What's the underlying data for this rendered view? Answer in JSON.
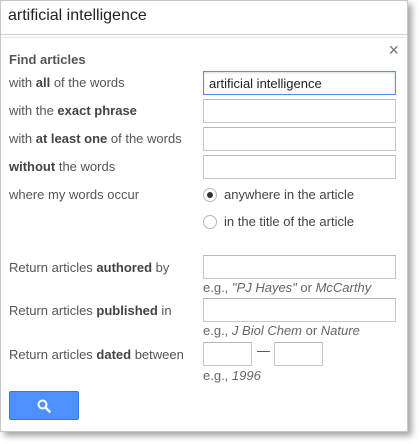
{
  "query": "artificial intelligence",
  "heading": "Find articles",
  "close_glyph": "×",
  "rows": {
    "all_words": {
      "pre": "with ",
      "bold": "all",
      "post": " of the words",
      "value": "artificial intelligence"
    },
    "exact_phrase": {
      "pre": "with the ",
      "bold": "exact phrase",
      "post": "",
      "value": ""
    },
    "at_least_one": {
      "pre": "with ",
      "bold": "at least one",
      "post": " of the words",
      "value": ""
    },
    "without": {
      "pre": "",
      "bold": "without",
      "post": " the words",
      "value": ""
    },
    "where": {
      "label": "where my words occur"
    },
    "authored": {
      "pre": "Return articles ",
      "bold": "authored",
      "post": " by",
      "value": ""
    },
    "published": {
      "pre": "Return articles ",
      "bold": "published",
      "post": " in",
      "value": ""
    },
    "dated": {
      "pre": "Return articles ",
      "bold": "dated",
      "post": " between",
      "value_from": "",
      "value_to": ""
    }
  },
  "occur_options": [
    {
      "label": "anywhere in the article",
      "selected": true
    },
    {
      "label": "in the title of the article",
      "selected": false
    }
  ],
  "hints": {
    "authored": {
      "prefix": "e.g., ",
      "ex1": "\"PJ Hayes\"",
      "mid": " or ",
      "ex2": "McCarthy"
    },
    "published": {
      "prefix": "e.g., ",
      "ex1": "J Biol Chem",
      "mid": " or ",
      "ex2": "Nature"
    },
    "dated": {
      "prefix": "e.g., ",
      "ex1": "1996"
    }
  },
  "date_separator": "—",
  "icons": {
    "search_button": "search-icon",
    "close": "close-icon"
  },
  "colors": {
    "accent": "#4d90fe",
    "accent_border": "#3079ed"
  }
}
